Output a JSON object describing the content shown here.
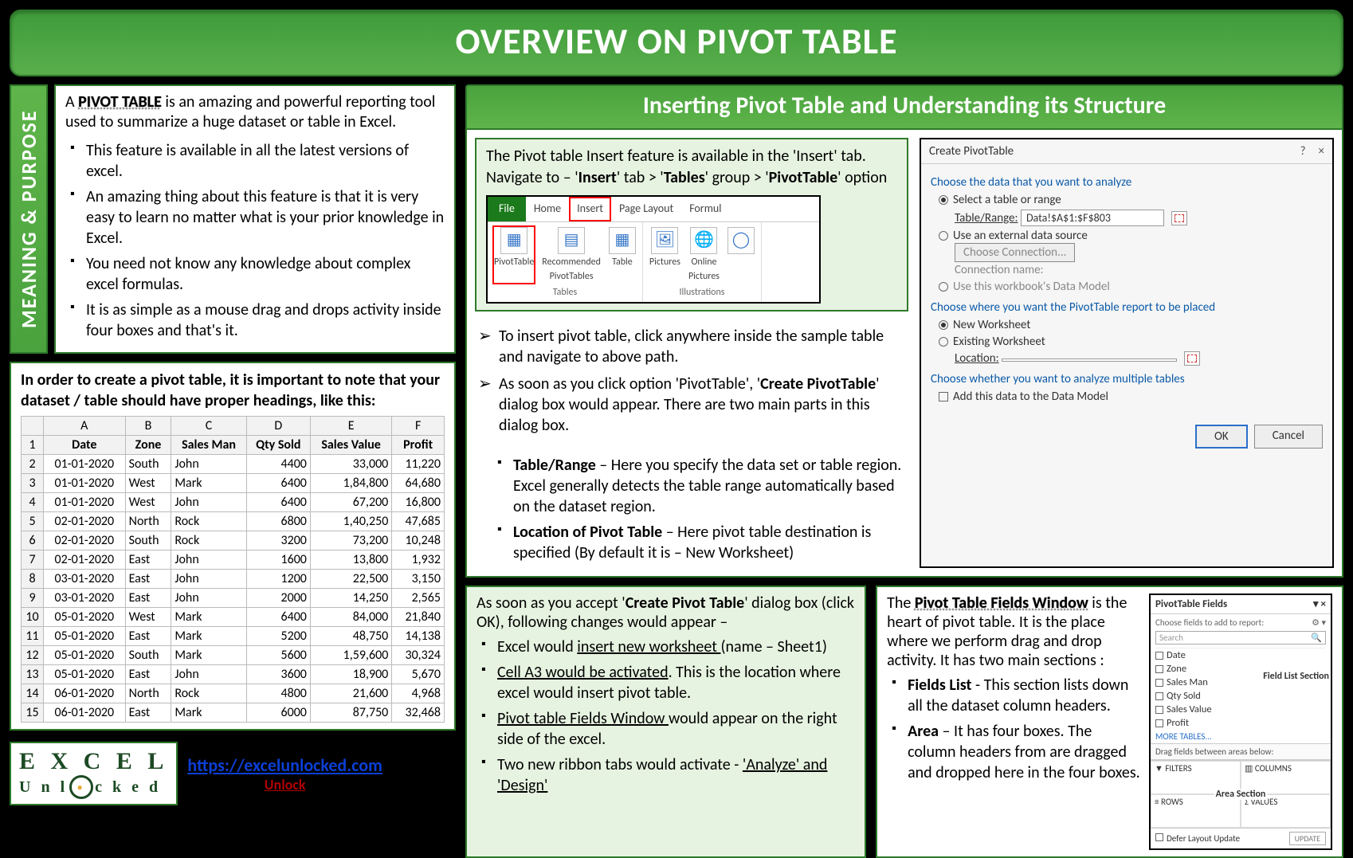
{
  "title": "OVERVIEW ON PIVOT TABLE",
  "meaning": {
    "tab": "MEANING  &  PURPOSE",
    "intro_a": "A ",
    "intro_term": "PIVOT TABLE",
    "intro_b": " is an amazing and powerful reporting tool used to summarize a huge dataset or table in Excel.",
    "bullets": [
      "This feature is available in all the latest versions of excel.",
      "An amazing thing about this feature is that it is very easy to learn no matter what is your prior knowledge in Excel.",
      "You need not know any knowledge about complex excel formulas.",
      "It is as simple as a mouse drag and drops activity inside four boxes and that's it."
    ]
  },
  "headings_note": "In order to create a pivot table, it is important to note that your dataset / table should have proper headings, like this:",
  "sample": {
    "cols": [
      "A",
      "B",
      "C",
      "D",
      "E",
      "F"
    ],
    "headers": [
      "Date",
      "Zone",
      "Sales Man",
      "Qty Sold",
      "Sales Value",
      "Profit"
    ],
    "rows": [
      [
        "01-01-2020",
        "South",
        "John",
        "4400",
        "33,000",
        "11,220"
      ],
      [
        "01-01-2020",
        "West",
        "Mark",
        "6400",
        "1,84,800",
        "64,680"
      ],
      [
        "01-01-2020",
        "West",
        "John",
        "6400",
        "67,200",
        "16,800"
      ],
      [
        "02-01-2020",
        "North",
        "Rock",
        "6800",
        "1,40,250",
        "47,685"
      ],
      [
        "02-01-2020",
        "South",
        "Rock",
        "3200",
        "73,200",
        "10,248"
      ],
      [
        "02-01-2020",
        "East",
        "John",
        "1600",
        "13,800",
        "1,932"
      ],
      [
        "03-01-2020",
        "East",
        "John",
        "1200",
        "22,500",
        "3,150"
      ],
      [
        "03-01-2020",
        "East",
        "John",
        "2000",
        "14,250",
        "2,565"
      ],
      [
        "05-01-2020",
        "West",
        "Mark",
        "6400",
        "84,000",
        "21,840"
      ],
      [
        "05-01-2020",
        "East",
        "Mark",
        "5200",
        "48,750",
        "14,138"
      ],
      [
        "05-01-2020",
        "South",
        "Mark",
        "5600",
        "1,59,600",
        "30,324"
      ],
      [
        "05-01-2020",
        "East",
        "John",
        "3600",
        "18,900",
        "5,670"
      ],
      [
        "06-01-2020",
        "North",
        "Rock",
        "4800",
        "21,600",
        "4,968"
      ],
      [
        "06-01-2020",
        "East",
        "Mark",
        "6000",
        "87,750",
        "32,468"
      ]
    ]
  },
  "section2": {
    "header": "Inserting Pivot Table and Understanding its Structure",
    "nav_a": "The Pivot table Insert feature is available in the 'Insert' tab. Navigate to – '",
    "nav_b": "Insert",
    "nav_c": "' tab > '",
    "nav_d": "Tables",
    "nav_e": "' group > '",
    "nav_f": "PivotTable",
    "nav_g": "' option",
    "ribbon": {
      "file": "File",
      "home": "Home",
      "insert": "Insert",
      "page": "Page Layout",
      "formul": "Formul",
      "pivot": "PivotTable",
      "rec1": "Recommended",
      "rec2": "PivotTables",
      "table": "Table",
      "pics": "Pictures",
      "online1": "Online",
      "online2": "Pictures",
      "grp_tables": "Tables",
      "grp_illus": "Illustrations"
    },
    "steps": [
      "To insert pivot table, click anywhere inside the sample table and navigate to above path.",
      "As soon as you click option 'PivotTable', '<b>Create PivotTable</b>' dialog box would appear. There are two main parts in this dialog box."
    ],
    "parts": [
      "<b>Table/Range</b> – Here you specify the data set or table region. Excel generally detects the table range automatically based on the dataset region.",
      "<b>Location of Pivot Table</b> – Here pivot table destination is specified (By default it is – New Worksheet)"
    ]
  },
  "dialog": {
    "title": "Create PivotTable",
    "q": "?",
    "x": "×",
    "analyze": "Choose the data that you want to analyze",
    "sel_range": "Select a table or range",
    "tr_label": "Table/Range:",
    "tr_value": "Data!$A$1:$F$803",
    "ext": "Use an external data source",
    "choose_conn": "Choose Connection...",
    "conn_name": "Connection name:",
    "use_model": "Use this workbook's Data Model",
    "place": "Choose where you want the PivotTable report to be placed",
    "newws": "New Worksheet",
    "exws": "Existing Worksheet",
    "loc": "Location:",
    "multi": "Choose whether you want to analyze multiple tables",
    "add_model": "Add this data to the Data Model",
    "ok": "OK",
    "cancel": "Cancel"
  },
  "after_ok": {
    "intro_a": "As soon as you accept '",
    "intro_b": "Create Pivot Table",
    "intro_c": "' dialog box (click OK), following changes would appear –",
    "items": [
      "Excel would <u>insert new worksheet </u>(name – Sheet1)",
      "<u>Cell A3 would be activated</u>. This is the location where excel would insert pivot table.",
      "<u>Pivot table Fields Window </u>would appear on the right side of the excel.",
      "Two new ribbon tabs would activate - <u>'Analyze' and 'Design'</u>"
    ]
  },
  "fields_text": {
    "intro_a": "The ",
    "intro_term": "Pivot Table Fields Window",
    "intro_b": " is the heart of pivot table. It is the place where we perform drag and drop activity. It has two main sections :",
    "items": [
      "<b>Fields List</b> - This section lists down all the dataset column headers.",
      "<b>Area</b> – It has four boxes. The column headers from are dragged and dropped here in the four boxes."
    ]
  },
  "fields_panel": {
    "title": "PivotTable Fields",
    "star": "▾ ×",
    "sub": "Choose fields to add to report:",
    "gear": "⚙ ▾",
    "search": "Search",
    "mag": "🔍",
    "list": [
      "Date",
      "Zone",
      "Sales Man",
      "Qty Sold",
      "Sales Value",
      "Profit"
    ],
    "fieldlist_caption": "Field List Section",
    "more": "MORE TABLES...",
    "drag": "Drag fields between areas below:",
    "filters": "▼ FILTERS",
    "columns": "▥ COLUMNS",
    "rows": "≡ ROWS",
    "values": "Σ VALUES",
    "area_caption": "Area Section",
    "defer": "Defer Layout Update",
    "update": "UPDATE"
  },
  "footer": {
    "logo_a": "E X C E L",
    "logo_b": "U n l   c k e d",
    "url": "https://excelunlocked.com",
    "unlock": "Unlock"
  }
}
